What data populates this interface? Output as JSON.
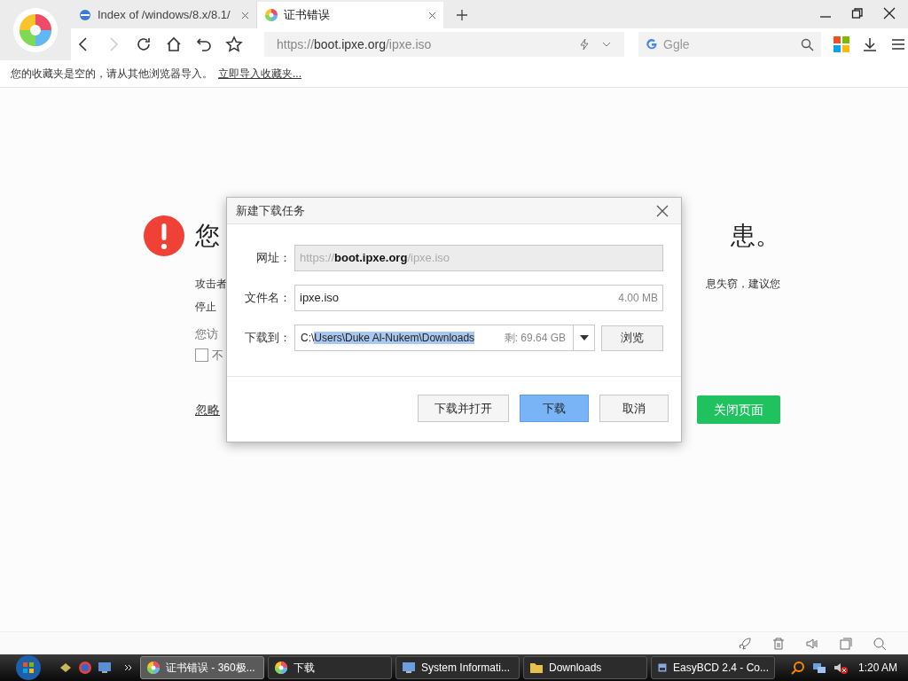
{
  "tabs": [
    {
      "title": "Index of /windows/8.x/8.1/",
      "kind": "ie",
      "selected": false
    },
    {
      "title": "证书错误",
      "kind": "swirl",
      "selected": true
    }
  ],
  "address": {
    "scheme": "https://",
    "host": "boot.ipxe.org",
    "path": "/ipxe.iso"
  },
  "search": {
    "placeholder": "Ggle"
  },
  "bookmarks_bar": {
    "message": "您的收藏夹是空的，请从其他浏览器导入。",
    "link": "立即导入收藏夹..."
  },
  "error_page": {
    "heading_left": "您",
    "heading_right": "患。",
    "line1_left": "攻击者",
    "line1_right": "息失窃，建议您",
    "line2_left": "停止",
    "line3_left": "您访",
    "checkbox": {
      "label": "不",
      "checked": false
    },
    "ignore_link": "忽略",
    "close_button": "关闭页面"
  },
  "dialog": {
    "title": "新建下载任务",
    "url_label": "网址：",
    "url": {
      "scheme": "https://",
      "host": "boot.ipxe.org",
      "path": "/ipxe.iso"
    },
    "filename_label": "文件名：",
    "filename": "ipxe.iso",
    "size": "4.00 MB",
    "dest_label": "下载到：",
    "dest_prefix": "C:\\",
    "dest_selected": "Users\\Duke Al-Nukem\\Downloads",
    "free_space": "剩: 69.64 GB",
    "browse": "浏览",
    "buttons": [
      {
        "label": "下载并打开",
        "primary": false
      },
      {
        "label": "下载",
        "primary": true
      },
      {
        "label": "取消",
        "primary": false
      }
    ]
  },
  "taskbar": {
    "items": [
      {
        "label": "证书错误 - 360极...",
        "kind": "swirl",
        "selected": true
      },
      {
        "label": "下载",
        "kind": "swirl",
        "selected": false
      },
      {
        "label": "System Informati...",
        "kind": "sysinfo",
        "selected": false
      },
      {
        "label": "Downloads",
        "kind": "folder",
        "selected": false
      },
      {
        "label": "EasyBCD 2.4 - Co...",
        "kind": "app",
        "selected": false
      }
    ],
    "clock": "1:20 AM"
  }
}
